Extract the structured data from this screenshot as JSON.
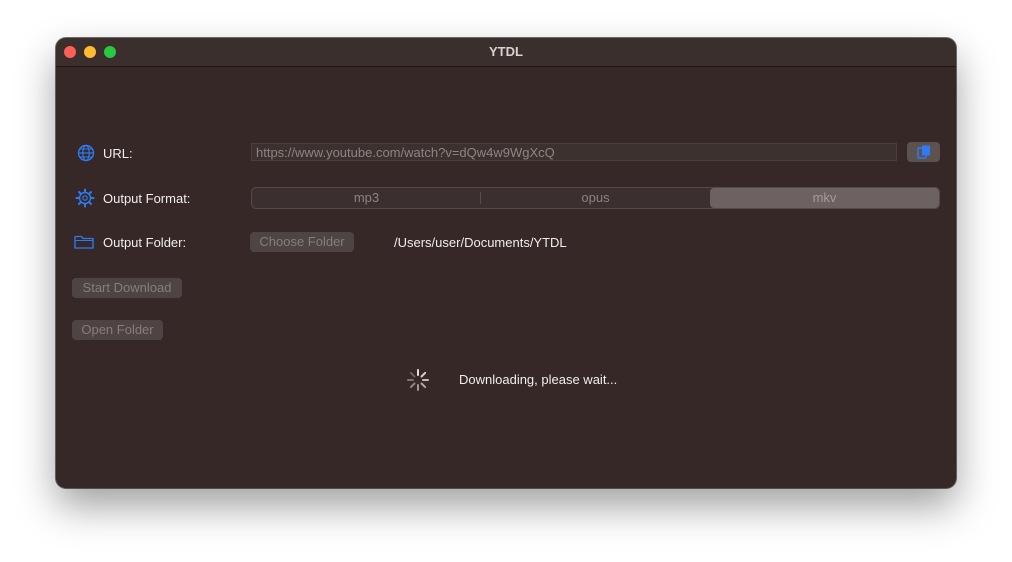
{
  "window": {
    "title": "YTDL"
  },
  "url": {
    "label": "URL:",
    "value": "https://www.youtube.com/watch?v=dQw4w9WgXcQ",
    "icon": "globe-icon",
    "paste_icon": "paste-icon"
  },
  "format": {
    "label": "Output Format:",
    "icon": "gear-icon",
    "options": [
      "mp3",
      "opus",
      "mkv"
    ],
    "selected": "mkv"
  },
  "folder": {
    "label": "Output Folder:",
    "icon": "folder-icon",
    "choose_label": "Choose Folder",
    "path": "/Users/user/Documents/YTDL"
  },
  "actions": {
    "start_label": "Start Download",
    "open_label": "Open Folder"
  },
  "status": {
    "text": "Downloading, please wait...",
    "icon": "spinner-icon"
  },
  "colors": {
    "window_bg": "#352827",
    "accent": "#2f7bf6",
    "close": "#fe5f57",
    "minimize": "#febc2e",
    "maximize": "#28c840"
  }
}
